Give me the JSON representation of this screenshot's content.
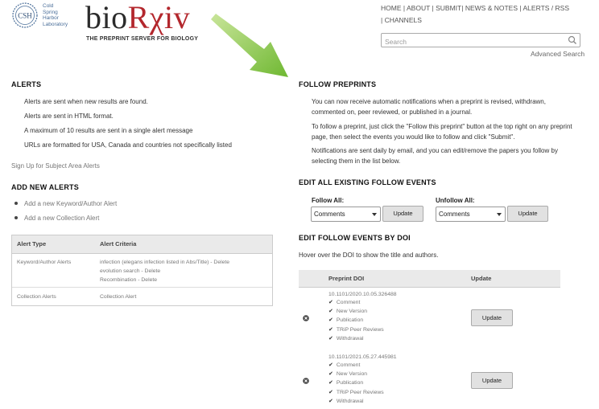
{
  "header": {
    "csh_abbrev": "CSH",
    "csh_lines": [
      "Cold",
      "Spring",
      "Harbor",
      "Laboratory"
    ],
    "logo_parts": [
      "bio",
      "Rχiv"
    ],
    "tagline": "THE PREPRINT SERVER FOR BIOLOGY",
    "nav": [
      "HOME",
      "ABOUT",
      "SUBMIT",
      "NEWS & NOTES",
      "ALERTS / RSS",
      "CHANNELS"
    ],
    "search_placeholder": "Search",
    "advanced_search": "Advanced Search"
  },
  "alerts": {
    "title": "ALERTS",
    "lines": [
      "Alerts are sent when new results are found.",
      "Alerts are sent in HTML format.",
      "A maximum of 10 results are sent in a single alert message",
      "URLs are formatted for USA, Canada and countries not specifically listed"
    ],
    "signup_link": "Sign Up for Subject Area Alerts"
  },
  "add_new": {
    "title": "ADD NEW ALERTS",
    "items": [
      "Add a new Keyword/Author Alert",
      "Add a new Collection Alert"
    ]
  },
  "alert_table": {
    "headers": [
      "Alert Type",
      "Alert Criteria"
    ],
    "rows": [
      {
        "type": "Keyword/Author Alerts",
        "criteria": [
          "infection (elegans infection listed in Abs/Title) - Delete",
          "evolution search - Delete",
          "Recombination - Delete"
        ]
      },
      {
        "type": "Collection Alerts",
        "criteria": [
          "Collection Alert"
        ]
      }
    ]
  },
  "follow": {
    "title": "FOLLOW PREPRINTS",
    "paragraphs": [
      "You can now receive automatic notifications when a preprint is revised, withdrawn, commented on, peer reviewed, or published in a journal.",
      "To follow a preprint, just click the \"Follow this preprint\" button at the top right on any preprint page, then select the events you would like to follow and click \"Submit\".",
      "Notifications are sent daily by email, and you can edit/remove the papers you follow by selecting them in the list below."
    ]
  },
  "edit_all": {
    "title": "EDIT ALL EXISTING FOLLOW EVENTS",
    "follow_all_label": "Follow All:",
    "unfollow_all_label": "Unfollow All:",
    "follow_select": "Comments",
    "unfollow_select": "Comments",
    "update_label": "Update"
  },
  "edit_doi": {
    "title": "EDIT FOLLOW EVENTS BY DOI",
    "hover_note": "Hover over the DOI to show the title and authors.",
    "headers": [
      "Preprint DOI",
      "Update"
    ],
    "entries": [
      {
        "doi": "10.1101/2020.10.05.326488",
        "events": [
          "Comment",
          "New Version",
          "Publication",
          "TRiP Peer Reviews",
          "Withdrawal"
        ],
        "update_label": "Update"
      },
      {
        "doi": "10.1101/2021.05.27.445981",
        "events": [
          "Comment",
          "New Version",
          "Publication",
          "TRiP Peer Reviews",
          "Withdrawal"
        ],
        "update_label": "Update"
      }
    ]
  },
  "colors": {
    "brand_red": "#b3272d",
    "arrow_green": "#7cc242",
    "csh_blue": "#4b6f9a"
  }
}
